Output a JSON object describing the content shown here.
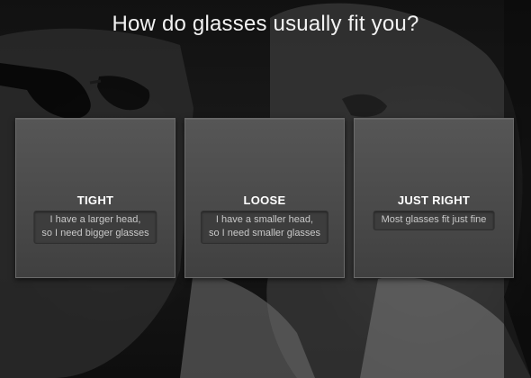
{
  "page": {
    "title": "How do glasses usually fit you?"
  },
  "options": [
    {
      "title": "TIGHT",
      "description_line1": "I have a larger head,",
      "description_line2": "so I need bigger glasses"
    },
    {
      "title": "LOOSE",
      "description_line1": "I have a smaller head,",
      "description_line2": "so I need smaller glasses"
    },
    {
      "title": "JUST RIGHT",
      "description_line1": "Most glasses fit just fine",
      "description_line2": ""
    }
  ],
  "colors": {
    "card_background": "#4e4e4e",
    "title_text": "#f2f2f2",
    "description_text": "#c9c9c9"
  }
}
